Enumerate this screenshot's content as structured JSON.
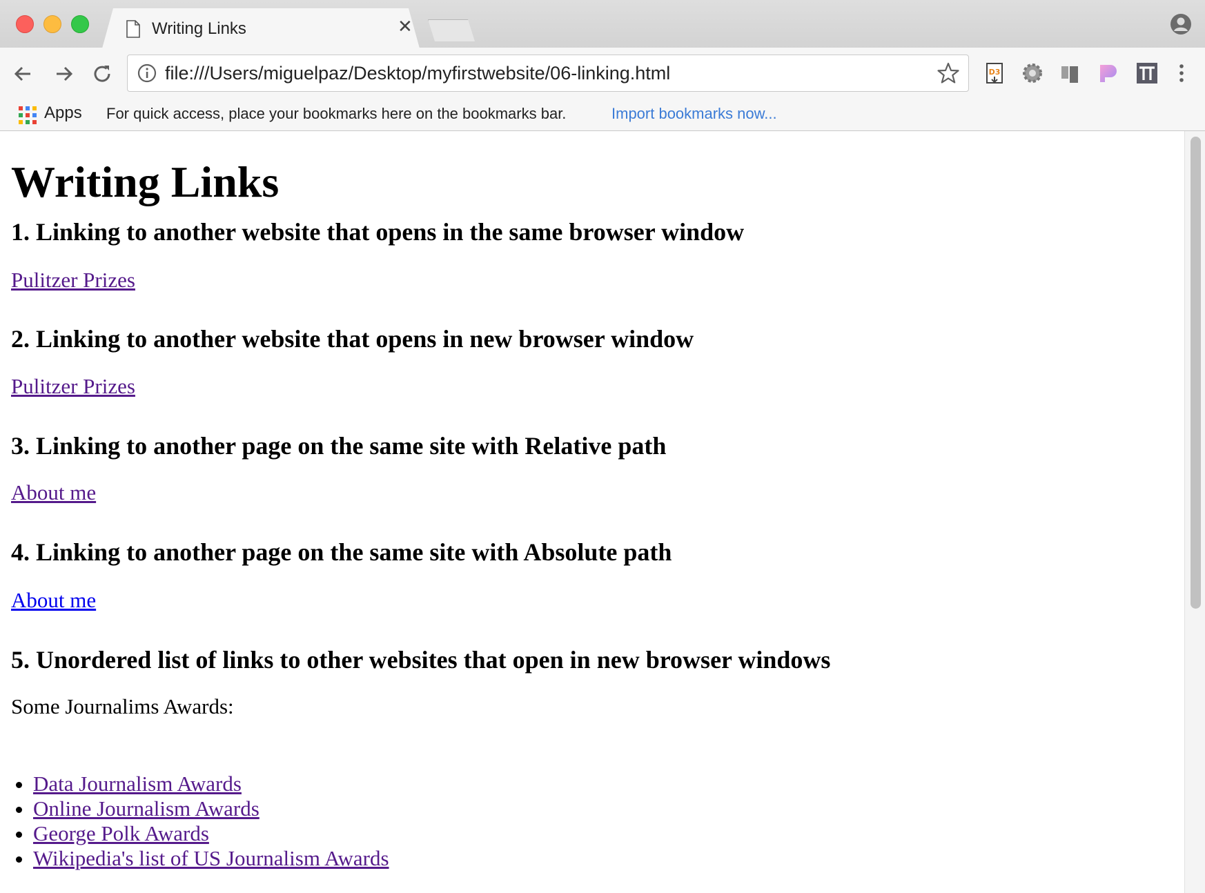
{
  "browser": {
    "tab": {
      "title": "Writing Links"
    },
    "omnibox": {
      "url": "file:///Users/miguelpaz/Desktop/myfirstwebsite/06-linking.html"
    },
    "bookmarks_bar": {
      "apps_label": "Apps",
      "hint": "For quick access, place your bookmarks here on the bookmarks bar.",
      "import_link": "Import bookmarks now..."
    },
    "icons": [
      "back-arrow-icon",
      "forward-arrow-icon",
      "reload-icon",
      "info-icon",
      "star-icon",
      "d3-extension-icon",
      "gear-extension-icon",
      "panels-extension-icon",
      "pink-extension-icon",
      "tt-extension-icon",
      "menu-dots-icon",
      "profile-icon"
    ]
  },
  "page": {
    "title": "Writing Links",
    "sections": [
      {
        "heading": "1. Linking to another website that opens in the same browser window",
        "link": "Pulitzer Prizes"
      },
      {
        "heading": "2. Linking to another website that opens in new browser window",
        "link": "Pulitzer Prizes"
      },
      {
        "heading": "3. Linking to another page on the same site with Relative path",
        "link": "About me"
      },
      {
        "heading": "4. Linking to another page on the same site with Absolute path",
        "link": "About me"
      },
      {
        "heading": "5. Unordered list of links to other websites that open in new browser windows"
      }
    ],
    "awards_intro": "Some Journalims Awards:",
    "awards": [
      "Data Journalism Awards",
      "Online Journalism Awards",
      "George Polk Awards",
      "Wikipedia's list of US Journalism Awards"
    ]
  },
  "colors": {
    "visited_link": "#551a8b",
    "unvisited_link": "#0000ee",
    "import_link": "#3b7bd6"
  }
}
